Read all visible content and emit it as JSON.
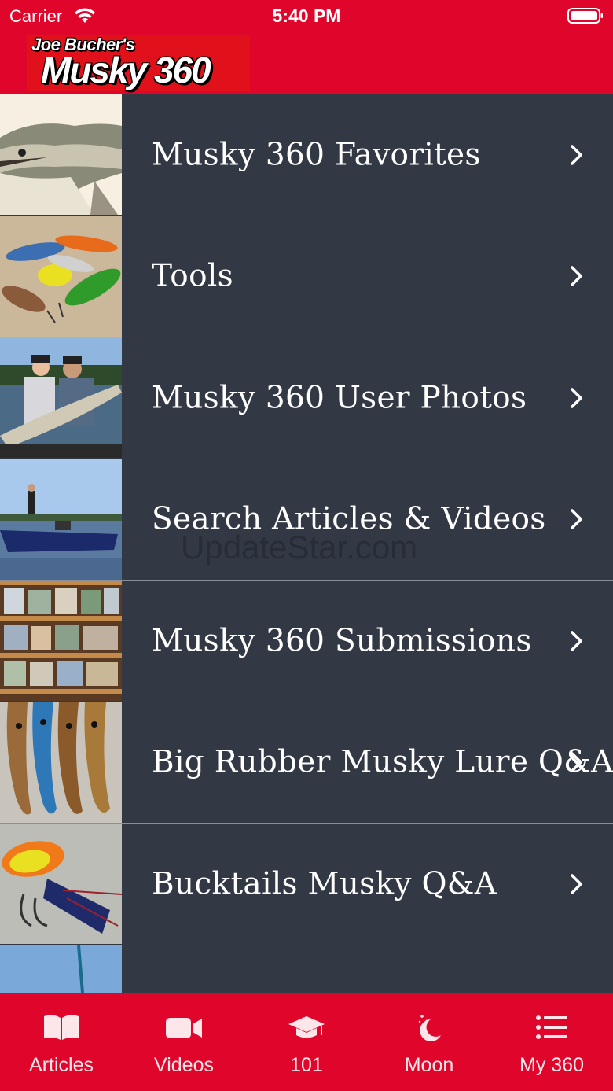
{
  "status": {
    "carrier": "Carrier",
    "time": "5:40 PM"
  },
  "header": {
    "logo_line1": "Joe Bucher's",
    "logo_line2": "Musky 360",
    "color": "#e0062b"
  },
  "menu": [
    {
      "label": "Musky 360 Favorites",
      "thumb": "musky-head"
    },
    {
      "label": "Tools",
      "thumb": "lures-pile"
    },
    {
      "label": "Musky 360 User Photos",
      "thumb": "anglers-with-musky"
    },
    {
      "label": "Search Articles & Videos",
      "thumb": "boat-on-lake"
    },
    {
      "label": "Musky 360 Submissions",
      "thumb": "photo-wall"
    },
    {
      "label": "Big Rubber Musky Lure Q&A",
      "thumb": "rubber-lures"
    },
    {
      "label": "Bucktails Musky Q&A",
      "thumb": "bucktail-lure"
    },
    {
      "label": "",
      "thumb": "fishing-rod-sky"
    }
  ],
  "watermark": "UpdateStar.com",
  "tabs": [
    {
      "label": "Articles",
      "icon": "book-icon"
    },
    {
      "label": "Videos",
      "icon": "video-camera-icon"
    },
    {
      "label": "101",
      "icon": "graduation-cap-icon"
    },
    {
      "label": "Moon",
      "icon": "moon-icon"
    },
    {
      "label": "My 360",
      "icon": "list-icon"
    }
  ],
  "colors": {
    "accent": "#e0062b",
    "list_bg": "#333845",
    "divider": "#8a8f9a"
  }
}
